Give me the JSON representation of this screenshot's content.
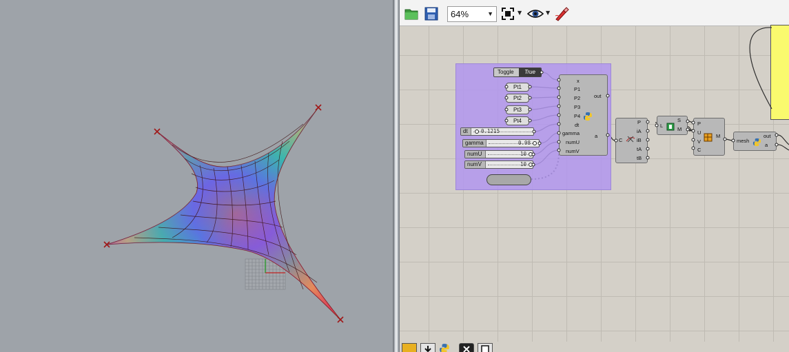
{
  "toolbar": {
    "open_icon": "folder-open-icon",
    "save_icon": "save-icon",
    "zoom_value": "64%",
    "zoom_fit_icon": "zoom-extents-icon",
    "preview_icon": "eye-icon",
    "sketch_icon": "pen-sketch-icon"
  },
  "colors": {
    "group_fill": "#b296ee",
    "panel_yellow": "#fafa6e",
    "canvas": "#d4d0c8",
    "viewport": "#9ea3a9"
  },
  "nodes": {
    "toggle": {
      "name": "Toggle",
      "value": "True"
    },
    "points": [
      "Pt1",
      "Pt2",
      "Pt3",
      "Pt4"
    ],
    "sliders": [
      {
        "name": "dt",
        "value": "0.1215"
      },
      {
        "name": "gamma",
        "value": "0.98"
      },
      {
        "name": "numU",
        "value": "10"
      },
      {
        "name": "numV",
        "value": "10"
      }
    ],
    "python1": {
      "inputs": [
        "x",
        "P1",
        "P2",
        "P3",
        "P4",
        "dt",
        "gamma",
        "numU",
        "numV"
      ],
      "outputs": [
        "out",
        "a"
      ]
    },
    "crv_comp": {
      "input": "C",
      "outputs": [
        "P",
        "iA",
        "iB",
        "tA",
        "tB"
      ]
    },
    "srf_comp": {
      "input": "L",
      "outputs": [
        "S",
        "M"
      ]
    },
    "mesh_comp": {
      "inputs": [
        "P",
        "U",
        "V",
        "C"
      ],
      "output": "M"
    },
    "python2": {
      "input": "mesh",
      "outputs": [
        "out",
        "a"
      ]
    }
  },
  "bottom_bar": {
    "icons": [
      "grasshopper-icon",
      "download-icon",
      "python-icon",
      "close-icon",
      "panel-icon"
    ]
  }
}
